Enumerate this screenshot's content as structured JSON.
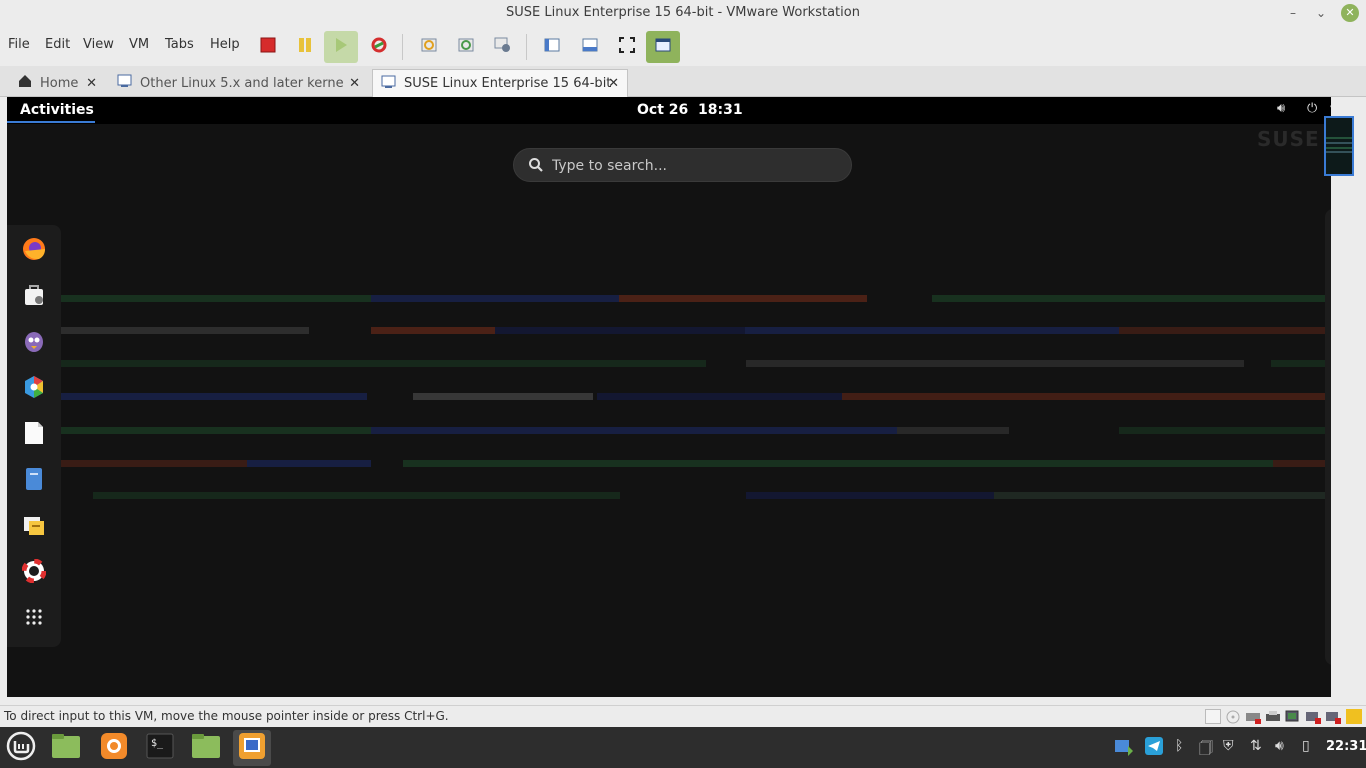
{
  "window": {
    "title": "SUSE Linux Enterprise 15 64-bit - VMware Workstation",
    "min_glyph": "–",
    "max_glyph": "⌄",
    "close_glyph": "✕"
  },
  "menu": {
    "file": "File",
    "edit": "Edit",
    "view": "View",
    "vm": "VM",
    "tabs": "Tabs",
    "help": "Help"
  },
  "toolbar_icons": [
    "power-off-icon",
    "suspend-icon",
    "power-on-icon",
    "reset-icon",
    "snapshot-icon",
    "revert-snapshot-icon",
    "manage-snapshots-icon",
    "show-library-icon",
    "thumbnail-bar-icon",
    "fullscreen-icon",
    "unity-icon"
  ],
  "tabs": [
    {
      "label": "Home",
      "icon": "home-icon",
      "close": "✕"
    },
    {
      "label": "Other Linux 5.x and later kerne...",
      "icon": "vm-icon",
      "close": "✕"
    },
    {
      "label": "SUSE Linux Enterprise 15 64-bit",
      "icon": "vm-icon",
      "close": "✕"
    }
  ],
  "vm": {
    "activities": "Activities",
    "clock": "Oct 26  18:31",
    "watermark": "SUSE",
    "search_placeholder": "Type to search...",
    "dock_items": [
      "firefox-icon",
      "software-icon",
      "pidgin-icon",
      "photos-icon",
      "document-icon",
      "files-icon",
      "yast-icon",
      "help-icon",
      "show-apps-icon"
    ]
  },
  "status": {
    "text": "To direct input to this VM, move the mouse pointer inside or press Ctrl+G."
  },
  "taskbar": {
    "clock": "22:31",
    "items": [
      "mint-menu-icon",
      "files-icon",
      "firefox-icon",
      "terminal-icon",
      "folder-icon",
      "vmware-icon"
    ]
  },
  "colors": {
    "accent_green": "#8fb35c",
    "gnome_blue": "#3a7bd5",
    "vm_bg": "#121212"
  }
}
